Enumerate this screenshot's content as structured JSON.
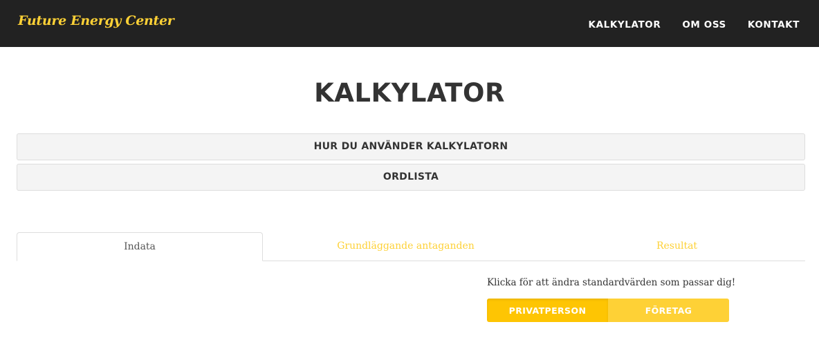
{
  "navbar": {
    "brand": "Future Energy Center",
    "links": [
      "KALKYLATOR",
      "OM OSS",
      "KONTAKT"
    ]
  },
  "page": {
    "title": "KALKYLATOR"
  },
  "accordion": {
    "how_to_use": "HUR DU ANVÄNDER KALKYLATORN",
    "glossary": "ORDLISTA"
  },
  "tabs": [
    {
      "label": "Indata",
      "active": true
    },
    {
      "label": "Grundläggande antaganden",
      "active": false
    },
    {
      "label": "Resultat",
      "active": false
    }
  ],
  "profile": {
    "prompt": "Klicka för att ändra standardvärden som passar dig!",
    "options": [
      "PRIVATPERSON",
      "FÖRETAG"
    ],
    "selected": "PRIVATPERSON"
  },
  "colors": {
    "navbar_bg": "#222222",
    "accent": "#fed136",
    "accent_active": "#fec503",
    "panel_bg": "#f4f4f4"
  }
}
